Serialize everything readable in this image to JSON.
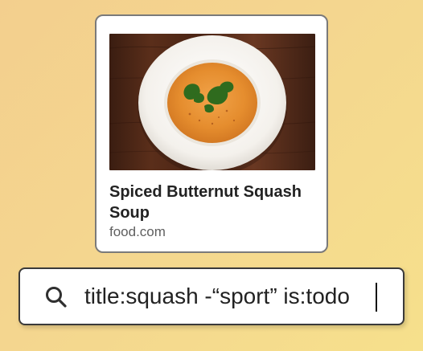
{
  "card": {
    "title": "Spiced Butternut Squash Soup",
    "source": "food.com",
    "image_icon": "soup-bowl-photo"
  },
  "search": {
    "icon": "search-icon",
    "value": "title:squash -“sport” is:todo"
  },
  "colors": {
    "background_start": "#f3cf8e",
    "background_end": "#f6e08c",
    "card_border": "#7a7a7a",
    "text_primary": "#222222",
    "text_secondary": "#5f5f5f"
  }
}
